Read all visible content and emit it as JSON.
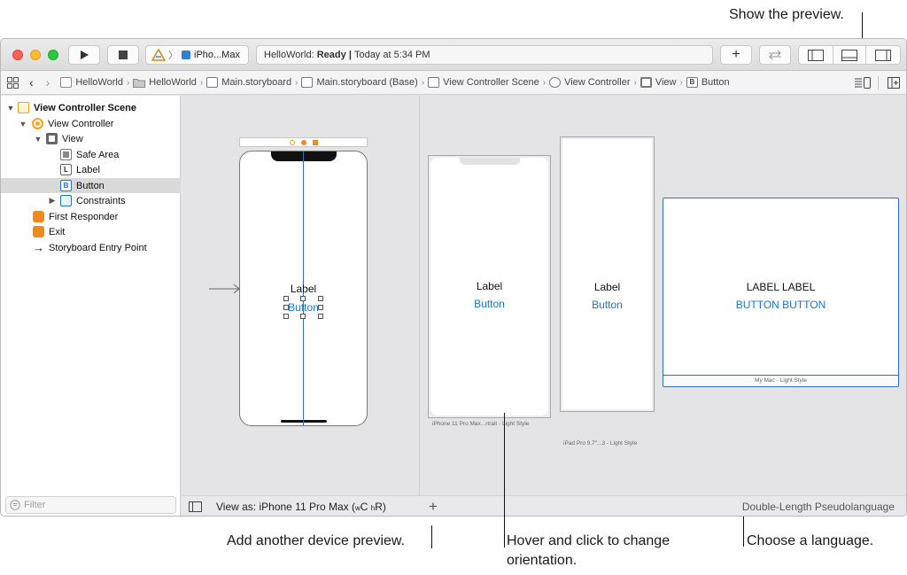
{
  "callouts": {
    "preview": "Show the preview.",
    "add_device": "Add another device preview.",
    "orientation": "Hover and click to change orientation.",
    "language": "Choose a language."
  },
  "toolbar": {
    "scheme_label": "iPho...Max",
    "status_app": "HelloWorld:",
    "status_state": "Ready",
    "status_sep": "|",
    "status_time": "Today at 5:34 PM",
    "add_symbol": "+"
  },
  "jumpbar": {
    "crumbs": [
      "HelloWorld",
      "HelloWorld",
      "Main.storyboard",
      "Main.storyboard (Base)",
      "View Controller Scene",
      "View Controller",
      "View",
      "Button"
    ]
  },
  "outline": {
    "items": [
      {
        "label": "View Controller Scene",
        "icon": "scene-icon"
      },
      {
        "label": "View Controller",
        "icon": "view-controller-icon"
      },
      {
        "label": "View",
        "icon": "view-icon"
      },
      {
        "label": "Safe Area",
        "icon": "safe-area-icon"
      },
      {
        "label": "Label",
        "icon": "label-icon",
        "glyph": "L"
      },
      {
        "label": "Button",
        "icon": "button-icon",
        "glyph": "B"
      },
      {
        "label": "Constraints",
        "icon": "constraints-icon"
      },
      {
        "label": "First Responder",
        "icon": "first-responder-icon"
      },
      {
        "label": "Exit",
        "icon": "exit-icon"
      },
      {
        "label": "Storyboard Entry Point",
        "icon": "entry-arrow-icon"
      }
    ],
    "filter_placeholder": "Filter"
  },
  "canvas": {
    "main_label": "Label",
    "main_button": "Button",
    "previews": [
      {
        "label": "Label",
        "button": "Button",
        "caption": "iPhone 11 Pro Max...rtrait - Light Style"
      },
      {
        "label": "Label",
        "button": "Button",
        "caption": "iPad Pro 9.7\"...3 - Light Style"
      },
      {
        "label": "LABEL LABEL",
        "button": "BUTTON BUTTON",
        "caption": "My Mac - Light Style"
      }
    ]
  },
  "bottombar": {
    "view_as": "View as: iPhone 11 Pro Max",
    "size_w": "w",
    "size_w_class": "C",
    "size_h": "h",
    "size_h_class": "R",
    "add_symbol": "+",
    "language": "Double-Length Pseudolanguage"
  },
  "colors": {
    "accent_blue": "#1a73d9",
    "orange": "#f5a623",
    "close": "#fe5f57",
    "minimize": "#febc2e",
    "zoom": "#28c840"
  }
}
